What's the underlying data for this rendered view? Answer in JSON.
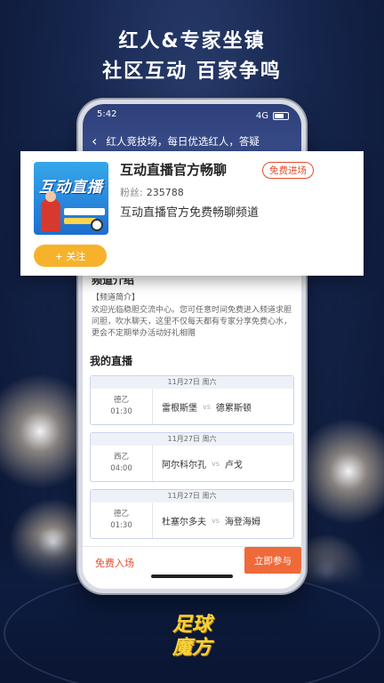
{
  "headline": {
    "line1": "红人&专家坐镇",
    "line2": "社区互动 百家争鸣"
  },
  "status": {
    "time": "5:42",
    "signal": "4G"
  },
  "nav": {
    "back_icon": "chevron-left-icon",
    "title": "红人竞技场，每日优选红人，答疑"
  },
  "card": {
    "thumb_text": "互动直播",
    "title": "互动直播官方畅聊",
    "badge": "免费进场",
    "fans_label": "粉丝:",
    "fans_count": "235788",
    "description": "互动直播官方免费畅聊频道",
    "follow_label": "+ 关注"
  },
  "intro": {
    "title": "频道介绍",
    "label": "【频道简介】",
    "text": "欢迎光临稳胆交流中心。您可任意时间免费进入频道求胆问胆，吹水聊天，这里不仅每天都有专家分享免费心水，更会不定期举办活动好礼相赠"
  },
  "live": {
    "title": "我的直播",
    "matches": [
      {
        "date": "11月27日 周六",
        "league": "德乙",
        "time": "01:30",
        "home": "雷根斯堡",
        "vs": "vs",
        "away": "德累斯顿"
      },
      {
        "date": "11月27日 周六",
        "league": "西乙",
        "time": "04:00",
        "home": "阿尔科尔孔",
        "vs": "vs",
        "away": "卢戈"
      },
      {
        "date": "11月27日 周六",
        "league": "德乙",
        "time": "01:30",
        "home": "杜塞尔多夫",
        "vs": "vs",
        "away": "海登海姆"
      }
    ]
  },
  "bottom": {
    "free_entry": "免费入场",
    "join": "立即参与"
  },
  "logo": {
    "line1": "足球",
    "line2": "魔方"
  },
  "colors": {
    "accent": "#ef6a3a",
    "follow": "#f7b22c",
    "nav": "#2e3f7a"
  }
}
